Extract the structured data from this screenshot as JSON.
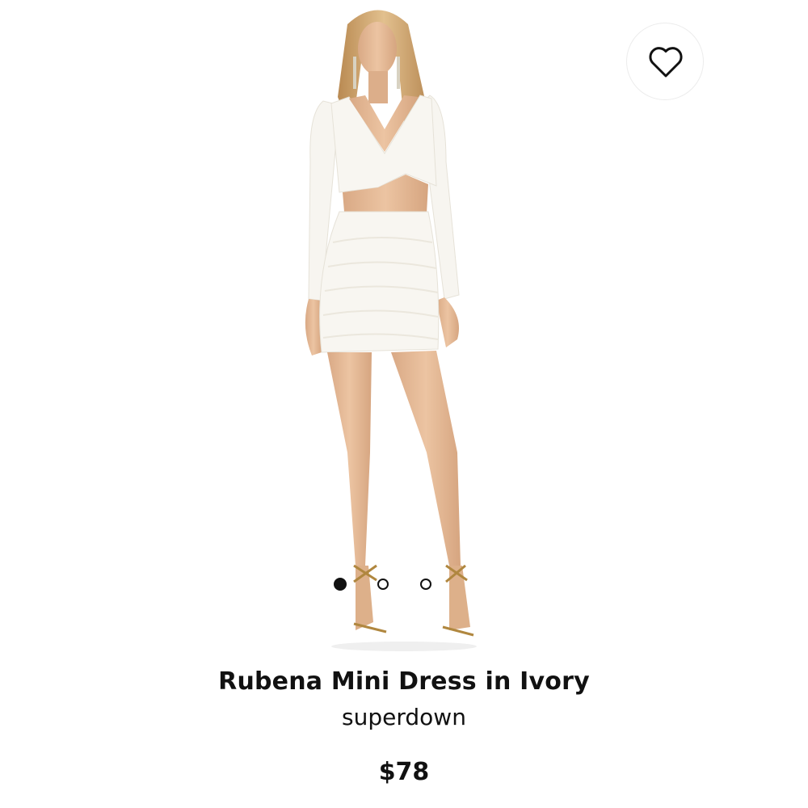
{
  "product": {
    "title": "Rubena Mini Dress in Ivory",
    "brand": "superdown",
    "price": "$78"
  },
  "gallery": {
    "image_count": 3,
    "active_index": 0
  },
  "icons": {
    "favorite": "heart-outline-icon"
  },
  "colors": {
    "text": "#111111",
    "background": "#ffffff",
    "dress": "#f6f4ef",
    "skin": "#e0b48f",
    "hair": "#c9a06a"
  }
}
